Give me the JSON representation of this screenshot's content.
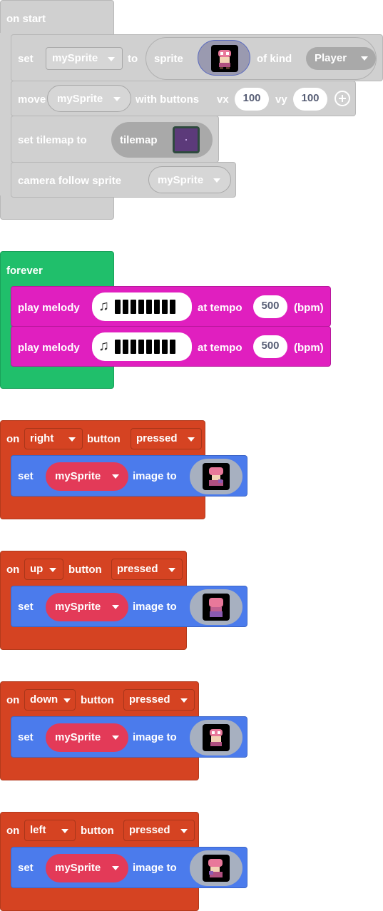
{
  "on_start": {
    "hat_label": "on start",
    "set_label": "set",
    "var_name": "mySprite",
    "to_label": "to",
    "sprite_label": "sprite",
    "of_kind_label": "of kind",
    "kind_value": "Player",
    "move_label": "move",
    "move_var": "mySprite",
    "with_buttons_label": "with buttons",
    "vx_label": "vx",
    "vx_value": "100",
    "vy_label": "vy",
    "vy_value": "100",
    "set_tilemap_label": "set tilemap to",
    "tilemap_label": "tilemap",
    "camera_label": "camera follow sprite",
    "camera_var": "mySprite"
  },
  "forever": {
    "hat_label": "forever",
    "melodies": [
      {
        "play_label": "play melody",
        "tempo_label": "at tempo",
        "tempo_value": "500",
        "unit_label": "(bpm)"
      },
      {
        "play_label": "play melody",
        "tempo_label": "at tempo",
        "tempo_value": "500",
        "unit_label": "(bpm)"
      }
    ]
  },
  "button_events": [
    {
      "on_label": "on",
      "button": "right",
      "button_label": "button",
      "event": "pressed",
      "set_label": "set",
      "var_name": "mySprite",
      "image_to_label": "image to"
    },
    {
      "on_label": "on",
      "button": "up",
      "button_label": "button",
      "event": "pressed",
      "set_label": "set",
      "var_name": "mySprite",
      "image_to_label": "image to"
    },
    {
      "on_label": "on",
      "button": "down",
      "button_label": "button",
      "event": "pressed",
      "set_label": "set",
      "var_name": "mySprite",
      "image_to_label": "image to"
    },
    {
      "on_label": "on",
      "button": "left",
      "button_label": "button",
      "event": "pressed",
      "set_label": "set",
      "var_name": "mySprite",
      "image_to_label": "image to"
    }
  ],
  "colors": {
    "on_start": "#d0d0d0",
    "on_start_inner": "#cccccc",
    "forever": "#20bf6b",
    "music": "#e01fbf",
    "controller": "#d54322",
    "sprites": "#4b7bec",
    "variable": "#e33a58"
  },
  "icons": {
    "add": "plus-circle-icon",
    "music": "music-note-icon",
    "sprite": "pink-character-thumbnail",
    "tilemap": "tilemap-thumbnail"
  }
}
